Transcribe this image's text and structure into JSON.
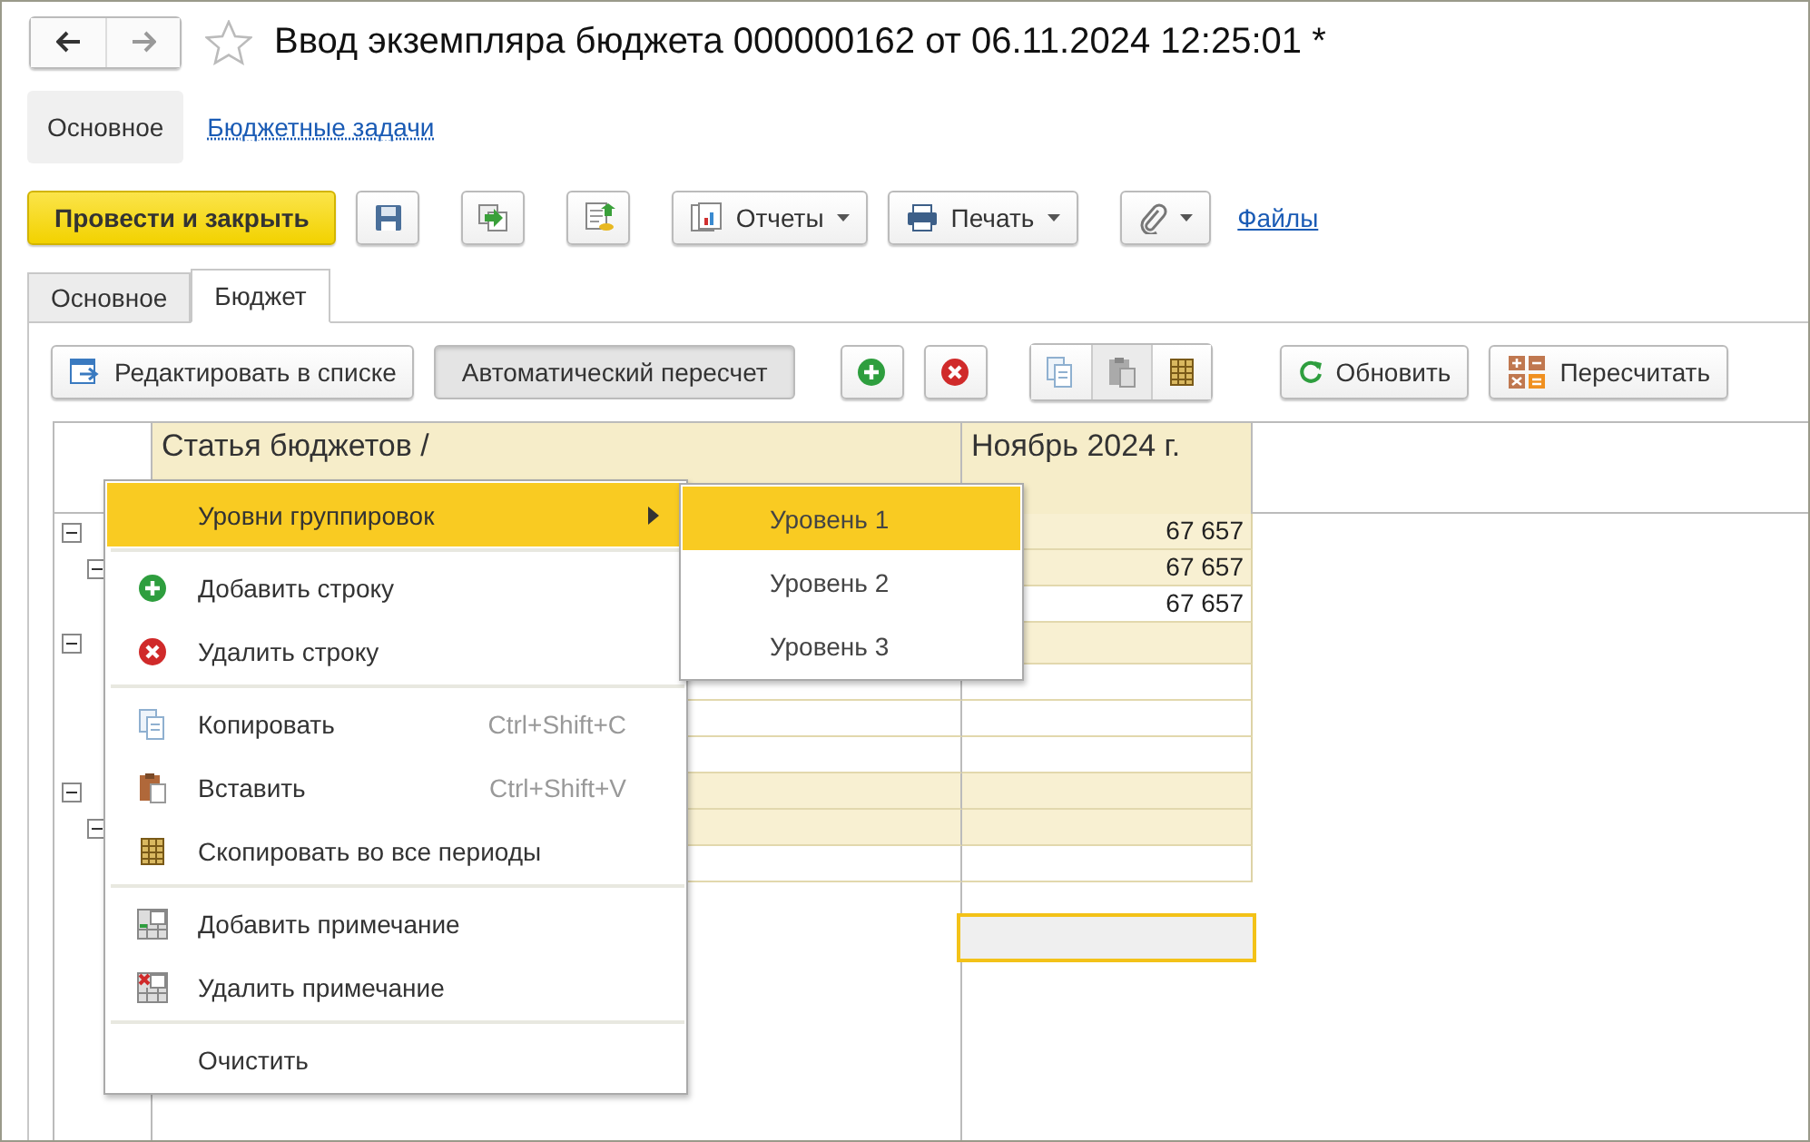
{
  "window": {
    "title": "Ввод экземпляра бюджета 000000162 от 06.11.2024 12:25:01 *"
  },
  "nav": [
    {
      "label": "Основное",
      "selected": true
    },
    {
      "label": "Бюджетные задачи",
      "selected": false
    }
  ],
  "command_bar": {
    "primary": "Провести и закрыть",
    "reports": "Отчеты",
    "print": "Печать",
    "files": "Файлы"
  },
  "tabs": [
    {
      "label": "Основное",
      "selected": false
    },
    {
      "label": "Бюджет",
      "selected": true
    }
  ],
  "table_toolbar": {
    "edit_in_list": "Редактировать в списке",
    "auto_recalc": {
      "label": "Автоматический пересчет",
      "on": true
    },
    "refresh": "Обновить",
    "recalculate": "Пересчитать"
  },
  "table": {
    "columns": [
      "Статья бюджетов /",
      "Ноябрь 2024 г."
    ],
    "rows": [
      {
        "expanded": true,
        "shaded": true,
        "value": "67 657",
        "children": [
          {
            "expanded": true,
            "shaded": true,
            "value": "67 657",
            "children": [
              {
                "shaded": false,
                "value": "67 657"
              }
            ]
          }
        ]
      },
      {
        "expanded": true,
        "shaded": true,
        "children": [
          {
            "shaded": false
          },
          {
            "shaded": false
          },
          {
            "shaded": false
          }
        ]
      },
      {
        "expanded": true,
        "shaded": true,
        "children": [
          {
            "expanded": true,
            "shaded": true,
            "children": [
              {
                "shaded": false
              }
            ]
          }
        ]
      }
    ]
  },
  "context_menu": {
    "groups": [
      [
        {
          "kind": "submenu",
          "label": "Уровни группировок",
          "selected": true
        }
      ],
      [
        {
          "kind": "add",
          "label": "Добавить строку",
          "selected": false
        },
        {
          "kind": "remove",
          "label": "Удалить строку",
          "selected": false
        }
      ],
      [
        {
          "kind": "copy",
          "label": "Копировать",
          "shortcut": "Ctrl+Shift+C",
          "selected": false
        },
        {
          "kind": "paste",
          "label": "Вставить",
          "shortcut": "Ctrl+Shift+V",
          "selected": false
        },
        {
          "kind": "copyall",
          "label": "Скопировать во все периоды",
          "selected": false
        }
      ],
      [
        {
          "kind": "addnote",
          "label": "Добавить примечание",
          "selected": false
        },
        {
          "kind": "removenote",
          "label": "Удалить примечание",
          "selected": false
        }
      ],
      [
        {
          "kind": "plain",
          "label": "Очистить",
          "selected": false
        }
      ]
    ]
  },
  "submenu": {
    "items": [
      {
        "label": "Уровень 1",
        "selected": true
      },
      {
        "label": "Уровень 2",
        "selected": false
      },
      {
        "label": "Уровень 3",
        "selected": false
      }
    ]
  }
}
